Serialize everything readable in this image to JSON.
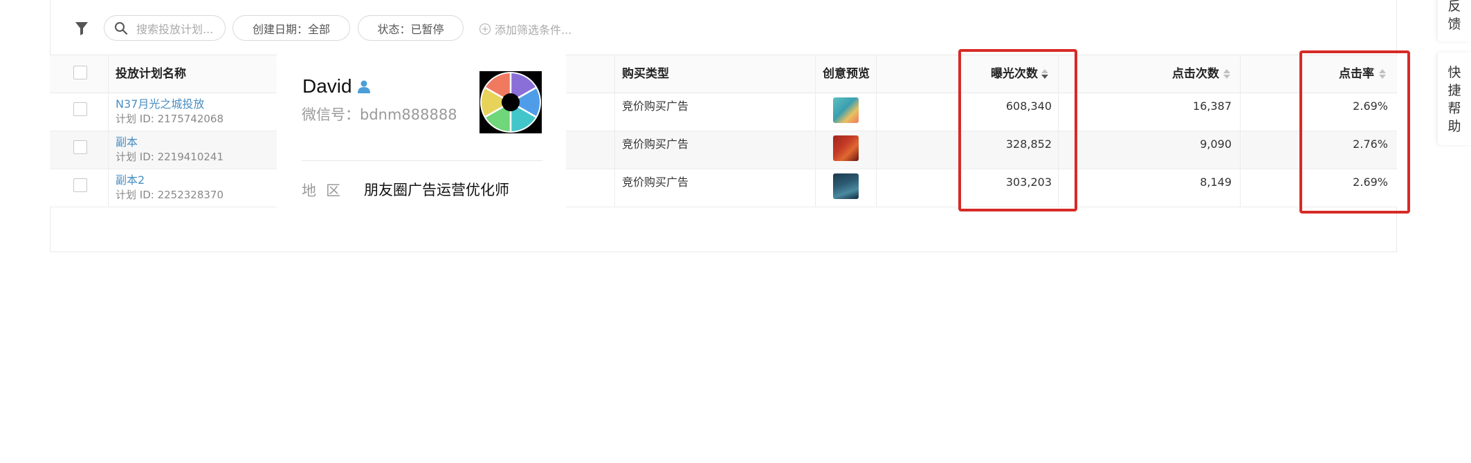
{
  "filters": {
    "search_placeholder": "搜索投放计划...",
    "date_pill": "创建日期：全部",
    "status_pill": "状态：已暂停",
    "add_filter": "添加筛选条件..."
  },
  "table": {
    "columns": {
      "name": "投放计划名称",
      "buy_type": "购买类型",
      "preview": "创意预览",
      "impressions": "曝光次数",
      "clicks": "点击次数",
      "ctr": "点击率"
    },
    "rows": [
      {
        "name": "N37月光之城投放",
        "plan_id": "计划 ID: 2175742068",
        "buy_type": "竞价购买广告",
        "impressions": "608,340",
        "clicks": "16,387",
        "ctr": "2.69%"
      },
      {
        "name": "副本",
        "plan_id": "计划 ID: 2219410241",
        "buy_type": "竞价购买广告",
        "impressions": "328,852",
        "clicks": "9,090",
        "ctr": "2.76%"
      },
      {
        "name": "副本2",
        "plan_id": "计划 ID: 2252328370",
        "buy_type": "竞价购买广告",
        "impressions": "303,203",
        "clicks": "8,149",
        "ctr": "2.69%"
      }
    ]
  },
  "card": {
    "name": "David",
    "wechat": "微信号：bdnm888888",
    "region_label": "地区",
    "region_value": "朋友圈广告运营优化师"
  },
  "side": {
    "feedback": [
      "反",
      "馈"
    ],
    "help": [
      "快",
      "捷",
      "帮",
      "助"
    ]
  },
  "colors": {
    "link": "#4a8ec2",
    "highlight": "#d72a26",
    "person_icon": "#4a9fd8"
  },
  "icons": {
    "filter": "filter-funnel-icon",
    "search": "magnifier-icon",
    "add": "circle-plus-icon",
    "sort": "sort-caret-icon",
    "person": "person-icon",
    "logo": "rainbow-aperture-logo"
  }
}
